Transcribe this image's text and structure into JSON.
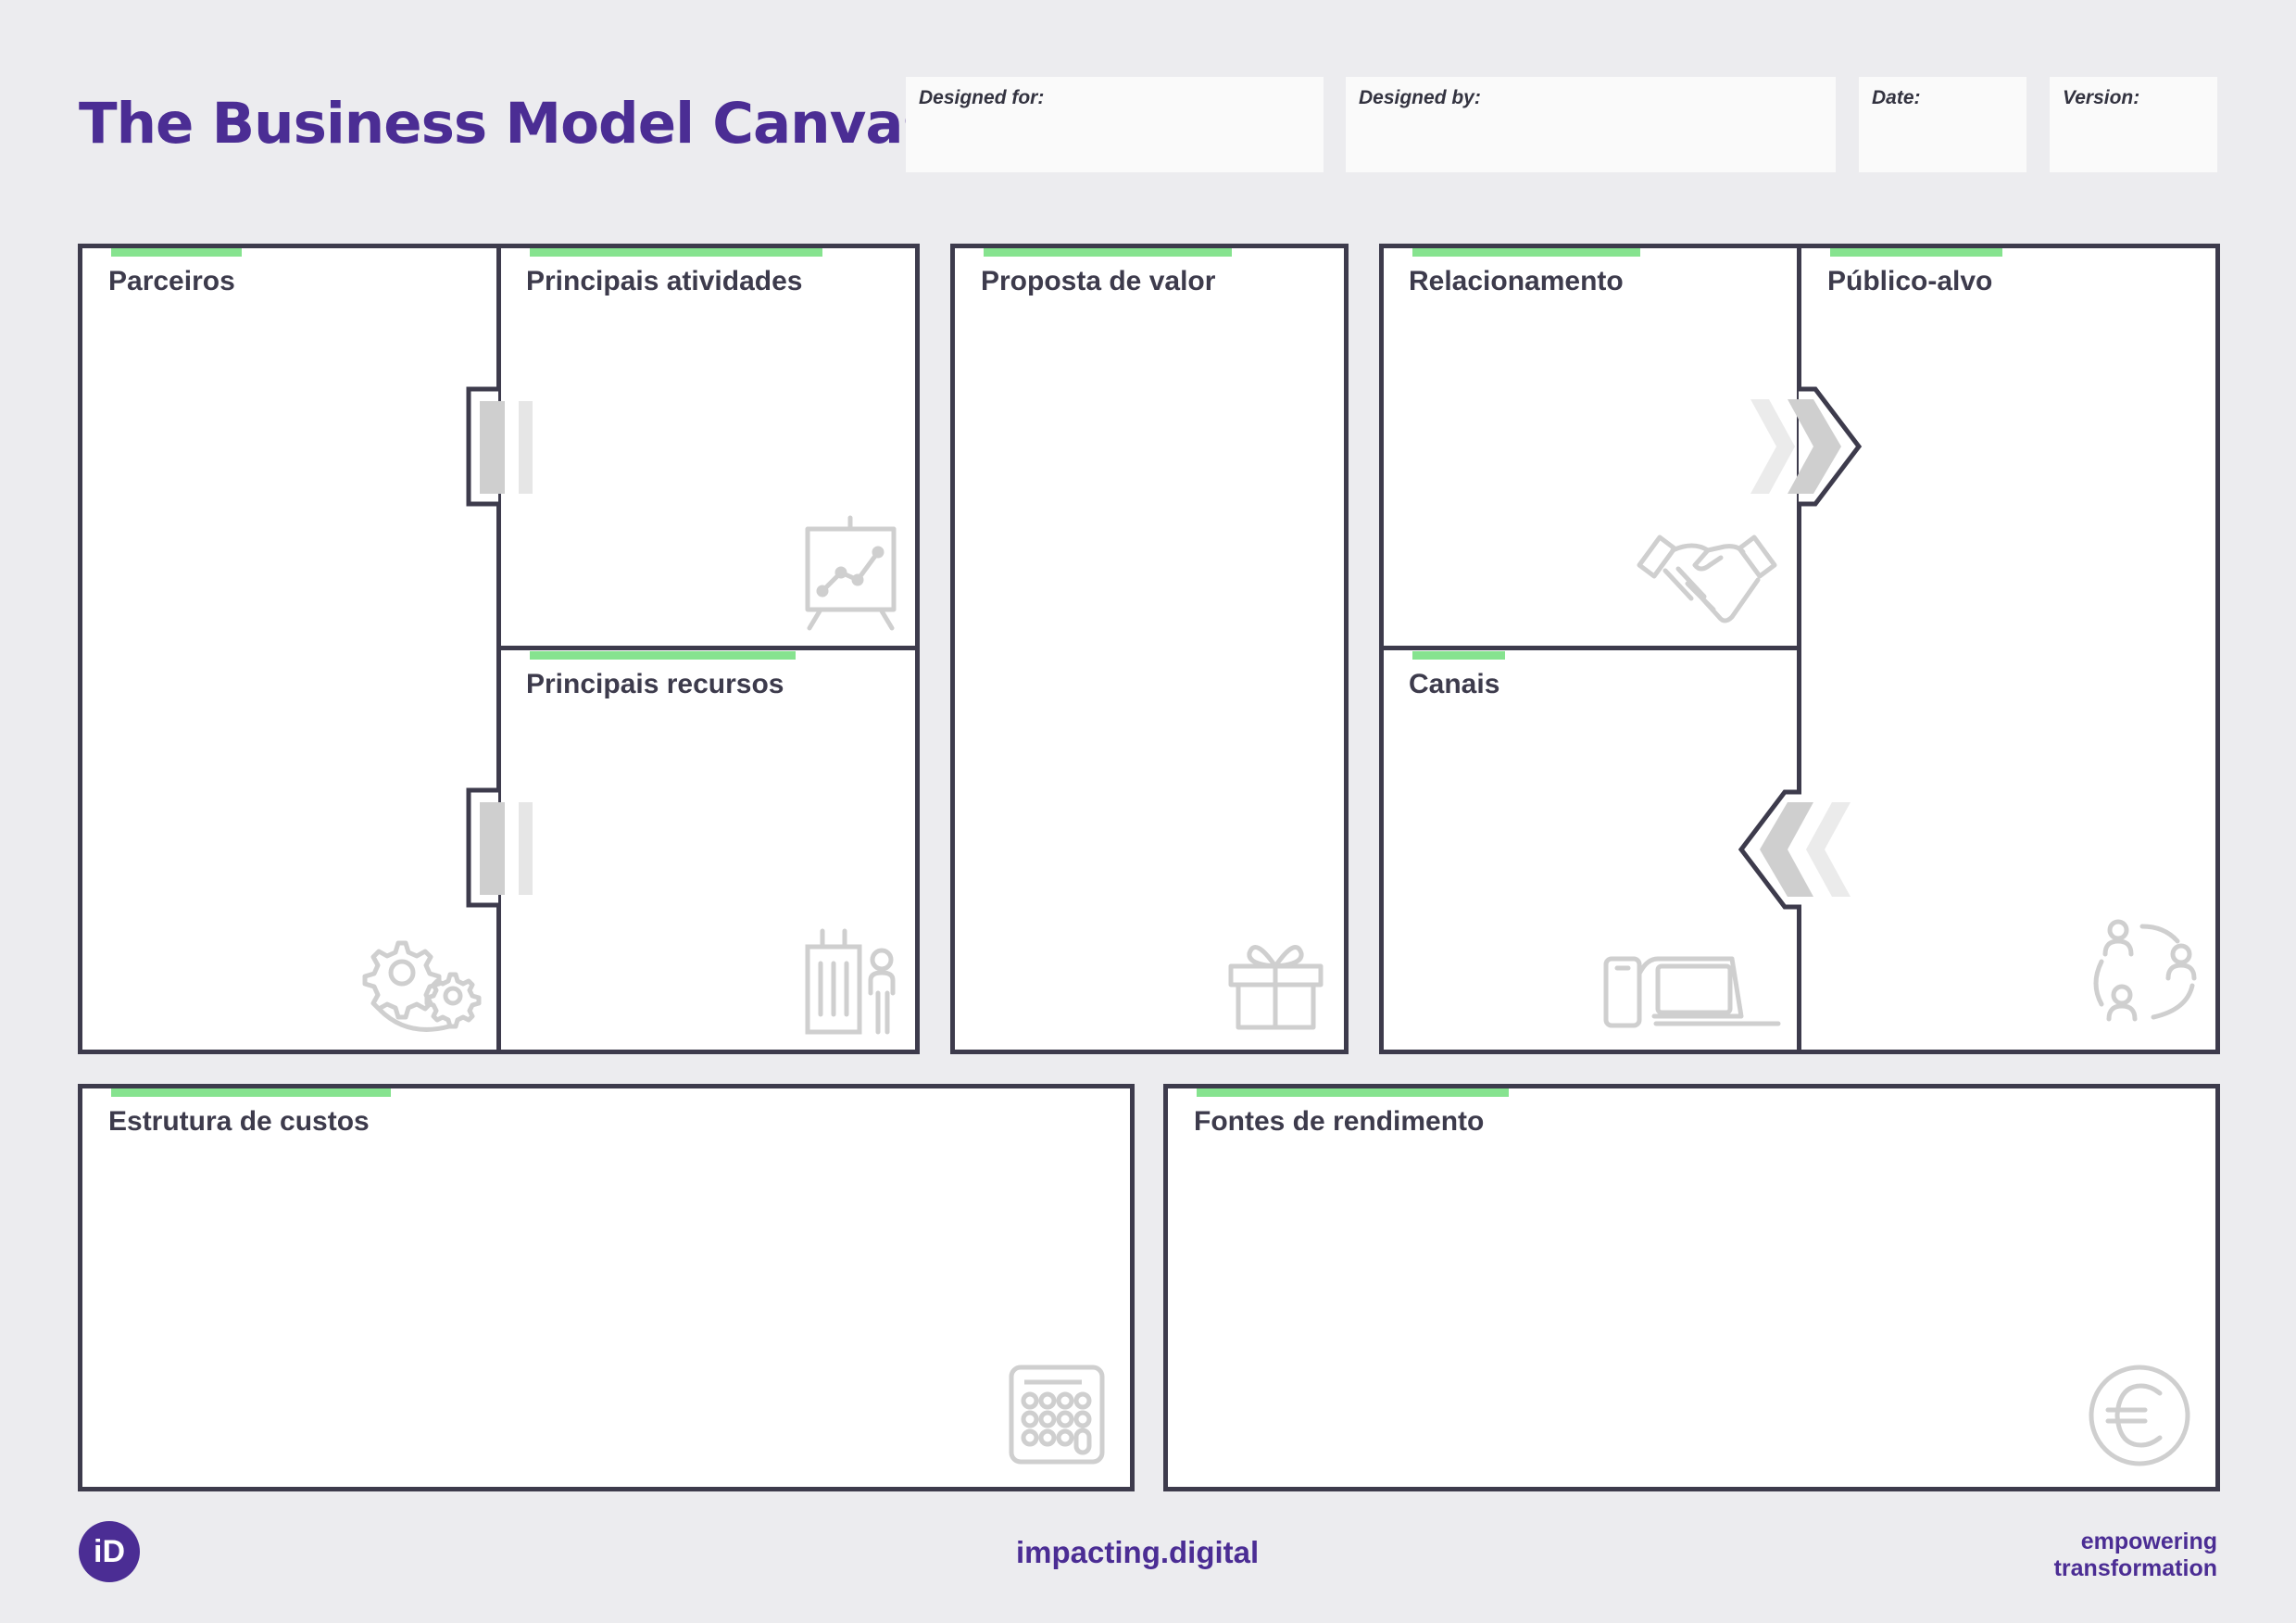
{
  "header": {
    "title": "The Business Model Canvas",
    "designed_for_label": "Designed for:",
    "designed_by_label": "Designed by:",
    "date_label": "Date:",
    "version_label": "Version:"
  },
  "blocks": {
    "parceiros": "Parceiros",
    "principais_atividades": "Principais atividades",
    "principais_recursos": "Principais recursos",
    "proposta_de_valor": "Proposta de valor",
    "relacionamento": "Relacionamento",
    "canais": "Canais",
    "publico_alvo": "Público-alvo",
    "estrutura_de_custos": "Estrutura  de custos",
    "fontes_de_rendimento": "Fontes de rendimento"
  },
  "footer": {
    "logo_text": "iD",
    "site": "impacting.digital",
    "tagline_line1": "empowering",
    "tagline_line2": "transformation"
  },
  "colors": {
    "accent_purple": "#4b2d94",
    "accent_green": "#86e38f",
    "border": "#3d3b4c",
    "background": "#ececef",
    "icon_gray": "#cfcfcf"
  },
  "icons": [
    "presentation-chart-icon",
    "gears-icon",
    "building-person-icon",
    "gift-icon",
    "handshake-icon",
    "devices-icon",
    "people-cycle-icon",
    "calculator-icon",
    "euro-coin-icon"
  ]
}
